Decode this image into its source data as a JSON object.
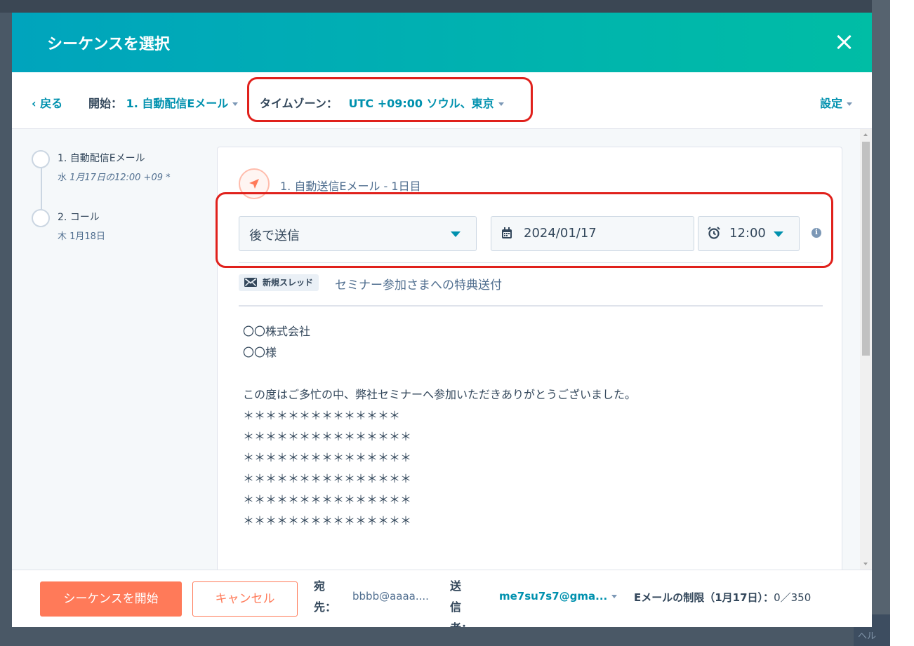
{
  "modal": {
    "title": "シーケンスを選択"
  },
  "toolbar": {
    "back": "‹ 戻る",
    "start_label": "開始：",
    "start_value": "1. 自動配信Eメール",
    "timezone_label": "タイムゾーン：",
    "timezone_value": "UTC +09:00 ソウル、東京",
    "settings": "設定"
  },
  "timeline": {
    "steps": [
      {
        "label": "1. 自動配信Eメール",
        "date_prefix": "水 ",
        "date": "1月17日の12:00 +09 *"
      },
      {
        "label": "2. コール",
        "date_prefix": "木 1月18日",
        "date": ""
      }
    ]
  },
  "step": {
    "title": "1. 自動送信Eメール - 1日目",
    "send_option": "後で送信",
    "date": "2024/01/17",
    "time": "12:00",
    "info_icon": "i"
  },
  "email": {
    "thread_tag": "新規スレッド",
    "subject": "セミナー参加さまへの特典送付",
    "body_lines": [
      "〇〇株式会社",
      "〇〇様",
      "",
      "この度はご多忙の中、弊社セミナーへ参加いただきありがとうございました。",
      "＊＊＊＊＊＊＊＊＊＊＊＊＊＊",
      "＊＊＊＊＊＊＊＊＊＊＊＊＊＊＊",
      "＊＊＊＊＊＊＊＊＊＊＊＊＊＊＊",
      "＊＊＊＊＊＊＊＊＊＊＊＊＊＊＊",
      "＊＊＊＊＊＊＊＊＊＊＊＊＊＊＊",
      "＊＊＊＊＊＊＊＊＊＊＊＊＊＊＊"
    ]
  },
  "footer": {
    "start_button": "シーケンスを開始",
    "cancel_button": "キャンセル",
    "to_label": "宛先：",
    "to_value": "bbbb@aaaa....",
    "from_label": "送信者：",
    "from_value": "me7su7s7@gma...",
    "limit_label": "Eメールの制限（1月17日）：",
    "limit_value": "0／350"
  },
  "background": {
    "corner_text": "ヘル"
  },
  "colors": {
    "header_gradient_start": "#00a4bd",
    "header_gradient_end": "#00bda5",
    "link": "#0091ae",
    "primary_button": "#ff7a59",
    "annotation_red": "#e0211c"
  }
}
